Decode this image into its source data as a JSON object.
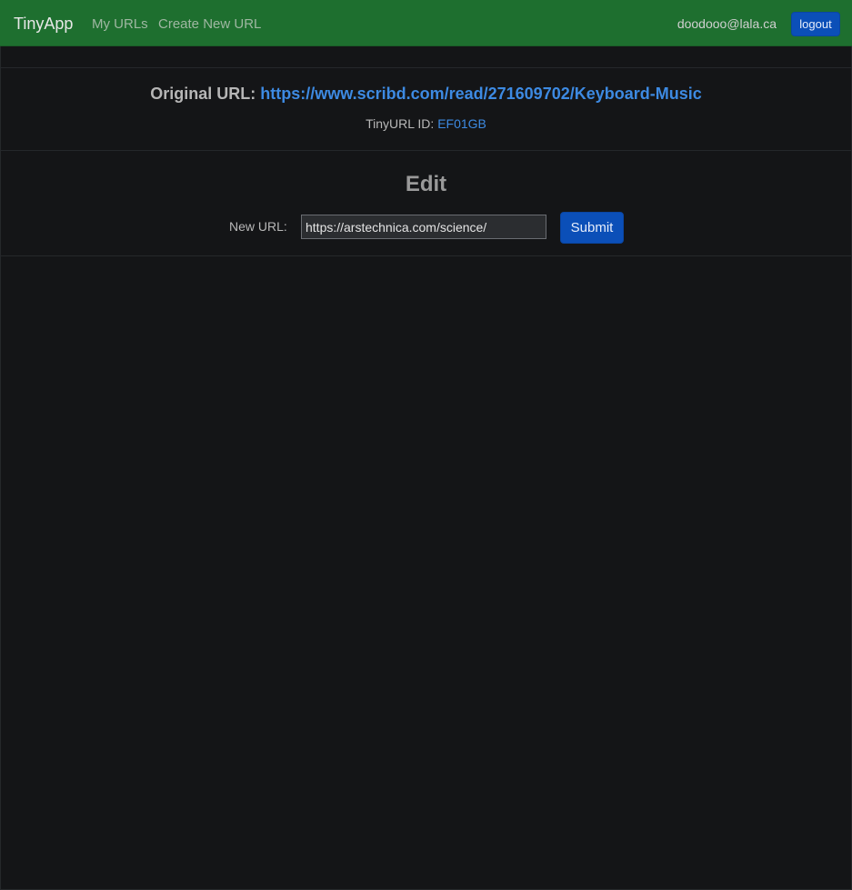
{
  "nav": {
    "brand": "TinyApp",
    "links": [
      "My URLs",
      "Create New URL"
    ],
    "user_email": "doodooo@lala.ca",
    "logout_label": "logout"
  },
  "details": {
    "original_label": "Original URL:",
    "original_url": "https://www.scribd.com/read/271609702/Keyboard-Music",
    "tiny_label": "TinyURL ID:",
    "tiny_id": "EF01GB"
  },
  "edit": {
    "heading": "Edit",
    "field_label": "New URL:",
    "field_value": "https://arstechnica.com/science/",
    "submit_label": "Submit"
  },
  "colors": {
    "navbar_bg": "#1e6f2f",
    "page_bg": "#141517",
    "link": "#3d8ae2",
    "button_bg": "#0b4fb8"
  }
}
